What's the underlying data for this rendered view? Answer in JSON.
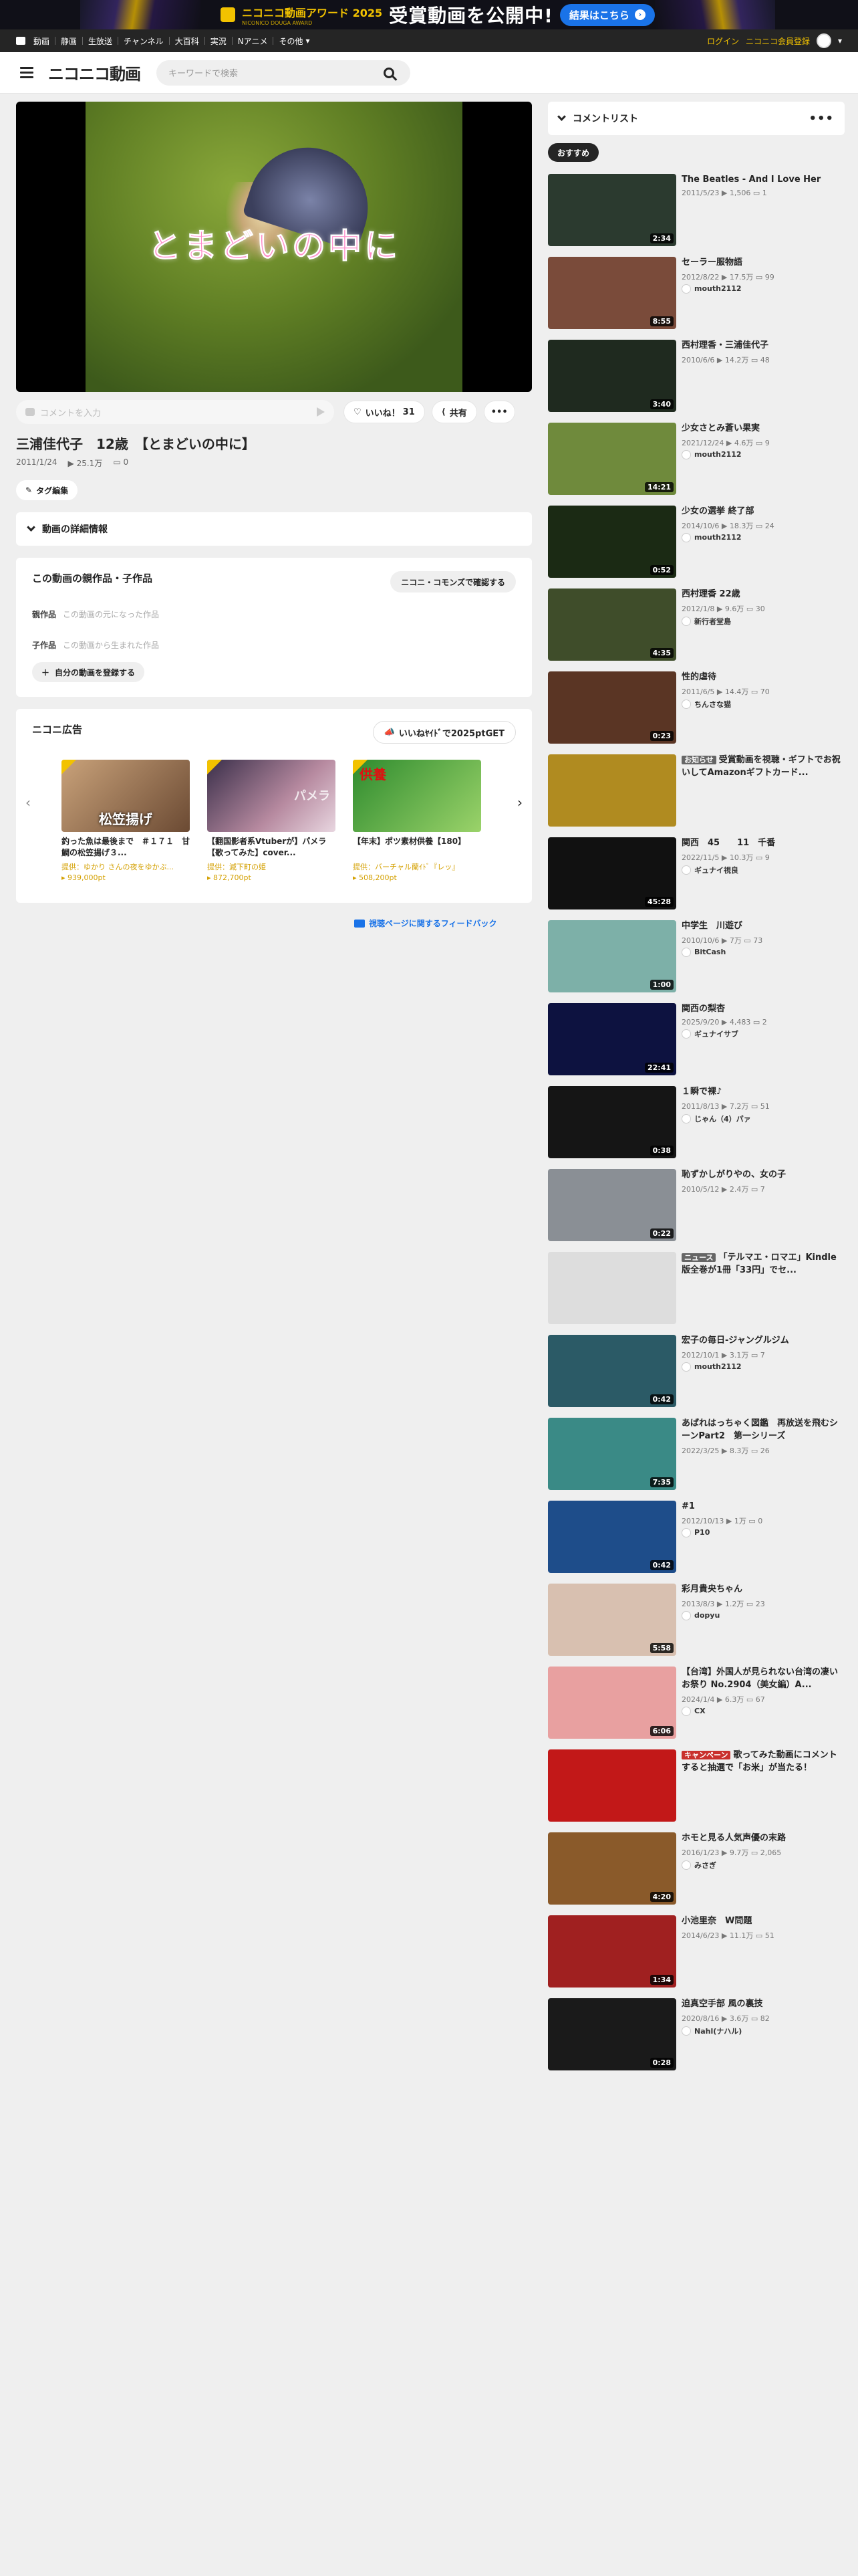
{
  "banner": {
    "award_name": "ニコニコ動画アワード 2025",
    "award_sub": "NICONICO DOUGA AWARD",
    "headline": "受賞動画を公開中!",
    "button": "結果はこちら"
  },
  "topnav": {
    "items": [
      "動画",
      "静画",
      "生放送",
      "チャンネル",
      "大百科",
      "実況",
      "Nアニメ",
      "その他"
    ],
    "login": "ログイン",
    "signup": "ニコニコ会員登録"
  },
  "header": {
    "logo": "ニコニコ動画",
    "search_placeholder": "キーワードで検索"
  },
  "player": {
    "subtitle": "とまどいの中に"
  },
  "comment_bar": {
    "placeholder": "コメントを入力",
    "like_label": "いいね！",
    "like_count": "31",
    "share": "共有"
  },
  "video": {
    "title": "三浦佳代子　12歳　【とまどいの中に】",
    "date": "2011/1/24",
    "views": "25.1万",
    "comments": "0",
    "tag_edit": "タグ編集",
    "detail": "動画の詳細情報"
  },
  "family": {
    "heading": "この動画の親作品・子作品",
    "commons_btn": "ニコニ・コモンズで確認する",
    "parent_label": "親作品",
    "parent_empty": "この動画の元になった作品",
    "child_label": "子作品",
    "child_empty": "この動画から生まれた作品",
    "register": "自分の動画を登録する"
  },
  "ads": {
    "heading": "ニコニ広告",
    "iine_btn": "いいねﾔｲﾄﾞで2025ptGET",
    "items": [
      {
        "title": "釣った魚は最後まで　＃１７１　甘鯛の松笠揚げ３...",
        "by": "提供：ゆかり さんの夜をゆかぶ...",
        "pt": "939,000pt",
        "thumb_text": "松笠揚げ"
      },
      {
        "title": "【翻国影者系Vtuberが】パメラ【歌ってみた】cover...",
        "by": "提供：滅下町の姫",
        "pt": "872,700pt",
        "thumb_text": "パメラ"
      },
      {
        "title": "【年末】ポツ素材供養【180】",
        "by": "提供：バーチャル蘭ｲﾄﾞ『レッ』",
        "pt": "508,200pt",
        "thumb_text": "供養"
      }
    ]
  },
  "feedback": "視聴ページに関するフィードバック",
  "sidebar": {
    "heading": "コメントリスト",
    "tab": "おすすめ",
    "items": [
      {
        "title": "The Beatles - And I Love Her",
        "date": "2011/5/23",
        "views": "1,506",
        "comments": "1",
        "owner": "",
        "duration": "2:34",
        "badge": ""
      },
      {
        "title": "セーラー服物語",
        "date": "2012/8/22",
        "views": "17.5万",
        "comments": "99",
        "owner": "mouth2112",
        "duration": "8:55",
        "badge": ""
      },
      {
        "title": "西村理香・三浦佳代子",
        "date": "2010/6/6",
        "views": "14.2万",
        "comments": "48",
        "owner": "",
        "duration": "3:40",
        "badge": ""
      },
      {
        "title": "少女さとみ蒼い果実",
        "date": "2021/12/24",
        "views": "4.6万",
        "comments": "9",
        "owner": "mouth2112",
        "duration": "14:21",
        "badge": ""
      },
      {
        "title": "少女の選挙 終了部",
        "date": "2014/10/6",
        "views": "18.3万",
        "comments": "24",
        "owner": "mouth2112",
        "duration": "0:52",
        "badge": ""
      },
      {
        "title": "西村理香 22歳",
        "date": "2012/1/8",
        "views": "9.6万",
        "comments": "30",
        "owner": "新行者堂島",
        "duration": "4:35",
        "badge": ""
      },
      {
        "title": "性的虐待",
        "date": "2011/6/5",
        "views": "14.4万",
        "comments": "70",
        "owner": "ちんさな猫",
        "duration": "0:23",
        "badge": ""
      },
      {
        "title": "受賞動画を視聴・ギフトでお祝いしてAmazonギフトカード...",
        "date": "",
        "views": "",
        "comments": "",
        "owner": "",
        "duration": "",
        "badge": "お知らせ"
      },
      {
        "title": "関西　45　　11　千番",
        "date": "2022/11/5",
        "views": "10.3万",
        "comments": "9",
        "owner": "ギュナイ視良",
        "duration": "45:28",
        "badge": ""
      },
      {
        "title": "中学生　川遊び",
        "date": "2010/10/6",
        "views": "7万",
        "comments": "73",
        "owner": "BitCash",
        "duration": "1:00",
        "badge": ""
      },
      {
        "title": "関西の梨杏",
        "date": "2025/9/20",
        "views": "4,483",
        "comments": "2",
        "owner": "ギュナイサブ",
        "duration": "22:41",
        "badge": ""
      },
      {
        "title": "１瞬で裸♪",
        "date": "2011/8/13",
        "views": "7.2万",
        "comments": "51",
        "owner": "じゃん（4）パァ",
        "duration": "0:38",
        "badge": ""
      },
      {
        "title": "恥ずかしがりやの、女の子",
        "date": "2010/5/12",
        "views": "2.4万",
        "comments": "7",
        "owner": "",
        "duration": "0:22",
        "badge": ""
      },
      {
        "title": "「テルマエ・ロマエ」Kindle版全巻が1冊「33円」でセ...",
        "date": "",
        "views": "",
        "comments": "",
        "owner": "",
        "duration": "",
        "badge": "ニュース"
      },
      {
        "title": "宏子の毎日-ジャングルジム",
        "date": "2012/10/1",
        "views": "3.1万",
        "comments": "7",
        "owner": "mouth2112",
        "duration": "0:42",
        "badge": ""
      },
      {
        "title": "あばれはっちゃく図鑑　再放送を飛むシーンPart2　第一シリーズ",
        "date": "2022/3/25",
        "views": "8.3万",
        "comments": "26",
        "owner": "",
        "duration": "7:35",
        "badge": ""
      },
      {
        "title": "#1",
        "date": "2012/10/13",
        "views": "1万",
        "comments": "0",
        "owner": "P10",
        "duration": "0:42",
        "badge": ""
      },
      {
        "title": "彩月貴央ちゃん",
        "date": "2013/8/3",
        "views": "1.2万",
        "comments": "23",
        "owner": "dopyu",
        "duration": "5:58",
        "badge": ""
      },
      {
        "title": "【台湾】外国人が見られない台湾の凄いお祭り No.2904（美女編）A...",
        "date": "2024/1/4",
        "views": "6.3万",
        "comments": "67",
        "owner": "CX",
        "duration": "6:06",
        "badge": ""
      },
      {
        "title": "歌ってみた動画にコメントすると抽選で「お米」が当たる！",
        "date": "",
        "views": "",
        "comments": "",
        "owner": "",
        "duration": "",
        "badge": "キャンペーン"
      },
      {
        "title": "ホモと見る人気声優の末路",
        "date": "2016/1/23",
        "views": "9.7万",
        "comments": "2,065",
        "owner": "みさぎ",
        "duration": "4:20",
        "badge": ""
      },
      {
        "title": "小池里奈　W問題",
        "date": "2014/6/23",
        "views": "11.1万",
        "comments": "51",
        "owner": "",
        "duration": "1:34",
        "badge": ""
      },
      {
        "title": "迫真空手部 風の裏技",
        "date": "2020/8/16",
        "views": "3.6万",
        "comments": "82",
        "owner": "Nahl(ナハル)",
        "duration": "0:28",
        "badge": ""
      }
    ]
  },
  "colors": {
    "accent": "#f2c200",
    "link": "#1a73e8",
    "dark": "#252525"
  }
}
